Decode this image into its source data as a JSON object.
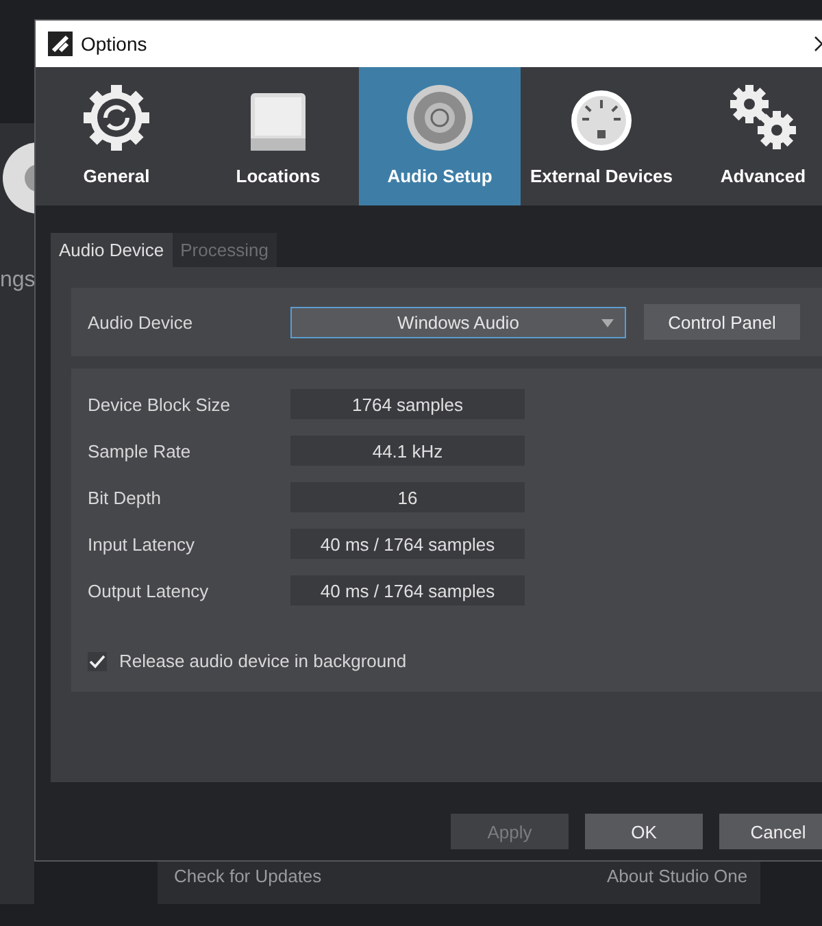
{
  "background": {
    "side_label": "ngs",
    "footer_links": [
      "Check for Updates",
      "About Studio One"
    ]
  },
  "window": {
    "title": "Options"
  },
  "tabs": [
    {
      "label": "General",
      "kind": "gear",
      "selected": false
    },
    {
      "label": "Locations",
      "kind": "drive",
      "selected": false
    },
    {
      "label": "Audio Setup",
      "kind": "speaker",
      "selected": true
    },
    {
      "label": "External Devices",
      "kind": "midi",
      "selected": false
    },
    {
      "label": "Advanced",
      "kind": "gears",
      "selected": false
    }
  ],
  "subtabs": [
    {
      "label": "Audio Device",
      "selected": true
    },
    {
      "label": "Processing",
      "selected": false
    }
  ],
  "device": {
    "label": "Audio Device",
    "value": "Windows Audio",
    "button": "Control Panel"
  },
  "properties": [
    {
      "label": "Device Block Size",
      "value": "1764 samples"
    },
    {
      "label": "Sample Rate",
      "value": "44.1 kHz"
    },
    {
      "label": "Bit Depth",
      "value": "16"
    },
    {
      "label": "Input Latency",
      "value": "40 ms / 1764 samples"
    },
    {
      "label": "Output Latency",
      "value": "40 ms / 1764 samples"
    }
  ],
  "release": {
    "label": "Release audio device in background",
    "checked": true
  },
  "buttons": [
    {
      "label": "Apply",
      "disabled": true
    },
    {
      "label": "OK",
      "disabled": false
    },
    {
      "label": "Cancel",
      "disabled": false
    }
  ]
}
